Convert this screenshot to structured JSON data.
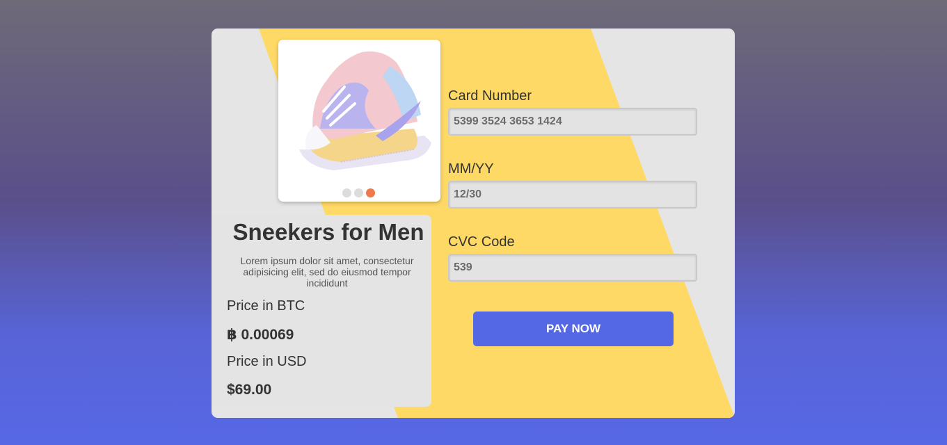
{
  "product": {
    "title": "Sneekers for Men",
    "description": "Lorem ipsum dolor sit amet, consectetur adipisicing elit, sed do eiusmod tempor incididunt",
    "image_icon": "sneaker-image",
    "carousel": {
      "count": 3,
      "active_index": 2
    }
  },
  "prices": {
    "btc_label": "Price in BTC",
    "btc_value": "฿ 0.00069",
    "usd_label": "Price in USD",
    "usd_value": "$69.00"
  },
  "form": {
    "card_number_label": "Card Number",
    "card_number_value": "5399 3524 3653 1424",
    "expiry_label": "MM/YY",
    "expiry_value": "12/30",
    "cvc_label": "CVC Code",
    "cvc_value": "539",
    "pay_button_label": "PAY NOW"
  },
  "colors": {
    "accent_stripe": "#ffd966",
    "button": "#5468e6",
    "card_background": "#e5e5e5",
    "active_dot": "#ee7a4c"
  }
}
